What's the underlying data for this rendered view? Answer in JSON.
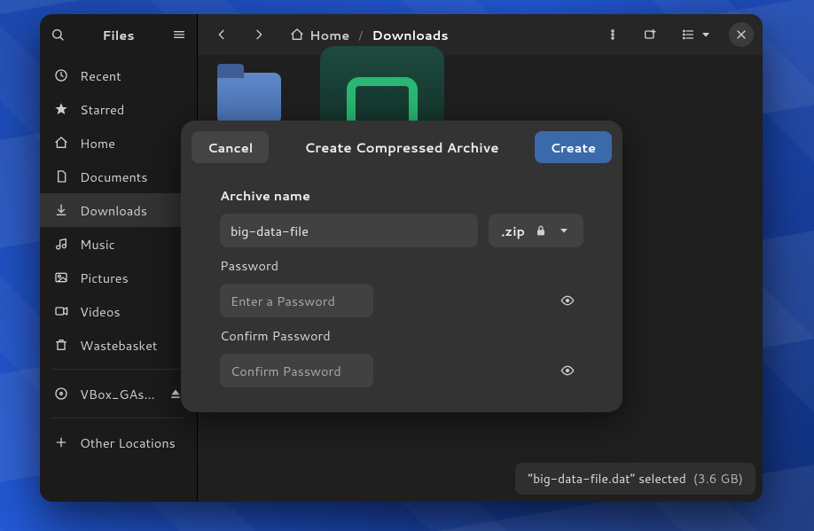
{
  "app": {
    "title": "Files"
  },
  "breadcrumb": {
    "root": "Home",
    "current": "Downloads"
  },
  "sidebar": {
    "items": [
      {
        "label": "Recent"
      },
      {
        "label": "Starred"
      },
      {
        "label": "Home"
      },
      {
        "label": "Documents"
      },
      {
        "label": "Downloads"
      },
      {
        "label": "Music"
      },
      {
        "label": "Pictures"
      },
      {
        "label": "Videos"
      },
      {
        "label": "Wastebasket"
      },
      {
        "label": "VBox_GAs…"
      },
      {
        "label": "Other Locations"
      }
    ]
  },
  "dialog": {
    "title": "Create Compressed Archive",
    "cancel": "Cancel",
    "create": "Create",
    "archive_name_label": "Archive name",
    "archive_name_value": "big-data-file",
    "extension": ".zip",
    "password_label": "Password",
    "password_placeholder": "Enter a Password",
    "confirm_label": "Confirm Password",
    "confirm_placeholder": "Confirm Password"
  },
  "status": {
    "text": "“big-data-file.dat” selected",
    "size": "(3.6 GB)"
  }
}
